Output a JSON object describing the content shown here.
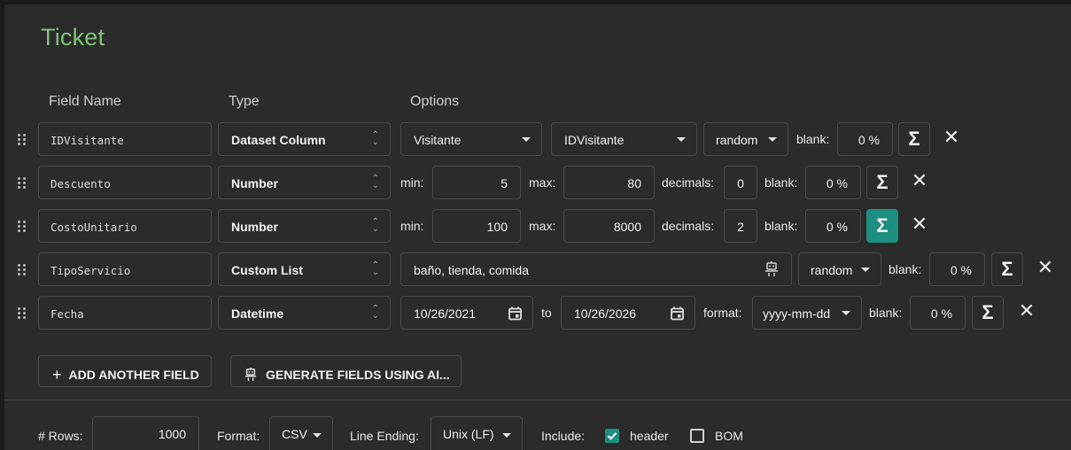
{
  "app": {
    "title": "Ticket"
  },
  "headers": {
    "field_name": "Field Name",
    "type": "Type",
    "options": "Options"
  },
  "rows": [
    {
      "name": "IDVisitante",
      "type": "Dataset Column",
      "dataset": "Visitante",
      "column": "IDVisitante",
      "mode": "random",
      "blank_label": "blank:",
      "blank": "0 %"
    },
    {
      "name": "Descuento",
      "type": "Number",
      "min_label": "min:",
      "min": "5",
      "max_label": "max:",
      "max": "80",
      "decimals_label": "decimals:",
      "decimals": "0",
      "blank_label": "blank:",
      "blank": "0 %"
    },
    {
      "name": "CostoUnitario",
      "type": "Number",
      "min_label": "min:",
      "min": "100",
      "max_label": "max:",
      "max": "8000",
      "decimals_label": "decimals:",
      "decimals": "2",
      "blank_label": "blank:",
      "blank": "0 %"
    },
    {
      "name": "TipoServicio",
      "type": "Custom List",
      "values": "baño, tienda, comida",
      "mode": "random",
      "blank_label": "blank:",
      "blank": "0 %"
    },
    {
      "name": "Fecha",
      "type": "Datetime",
      "from": "10/26/2021",
      "to_label": "to",
      "to": "10/26/2026",
      "format_label": "format:",
      "format": "yyyy-mm-dd",
      "blank_label": "blank:",
      "blank": "0 %"
    }
  ],
  "actions": {
    "add_field": "ADD ANOTHER FIELD",
    "generate_ai": "GENERATE FIELDS USING AI..."
  },
  "footer": {
    "rows_label": "# Rows:",
    "rows": "1000",
    "format_label": "Format:",
    "format": "CSV",
    "line_ending_label": "Line Ending:",
    "line_ending": "Unix (LF)",
    "include_label": "Include:",
    "header_label": "header",
    "header_checked": true,
    "bom_label": "BOM",
    "bom_checked": false
  },
  "colors": {
    "title": "#7cc576",
    "accent": "#1d8f80",
    "background": "#2b2b2b"
  }
}
